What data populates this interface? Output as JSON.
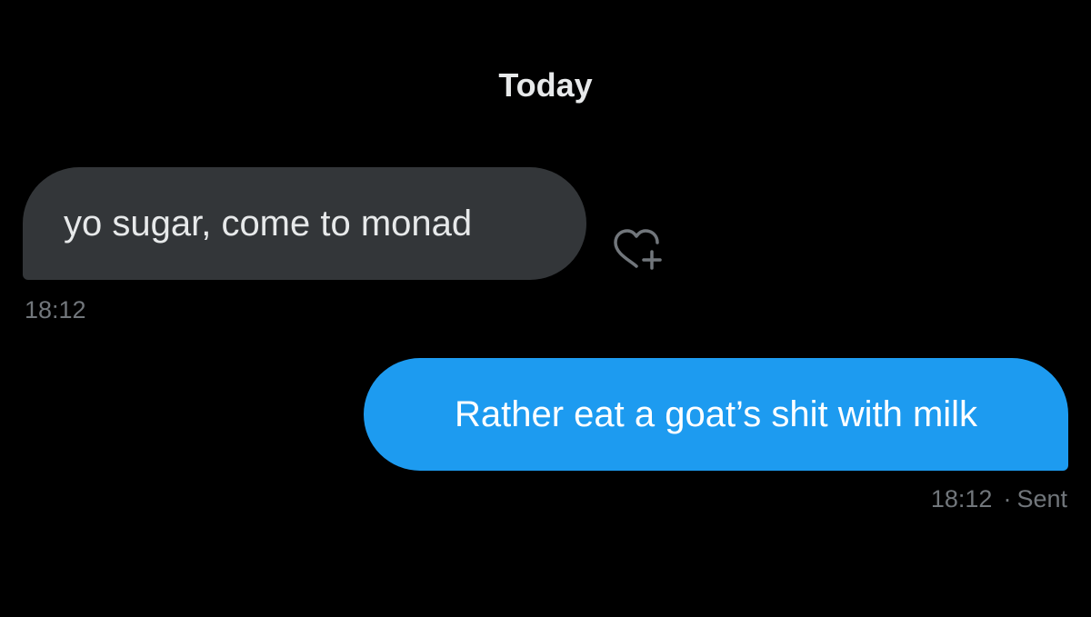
{
  "conversation": {
    "day_separator": "Today",
    "messages": [
      {
        "direction": "incoming",
        "text": "yo sugar, come to monad",
        "time": "18:12",
        "reaction_icon": "heart-plus-icon"
      },
      {
        "direction": "outgoing",
        "text": "Rather eat a goat’s shit with milk",
        "time": "18:12",
        "separator": "·",
        "status": "Sent"
      }
    ]
  },
  "colors": {
    "background": "#000000",
    "incoming_bubble": "#333639",
    "outgoing_bubble": "#1d9bf0",
    "primary_text": "#e7e9ea",
    "secondary_text": "#71767b"
  }
}
